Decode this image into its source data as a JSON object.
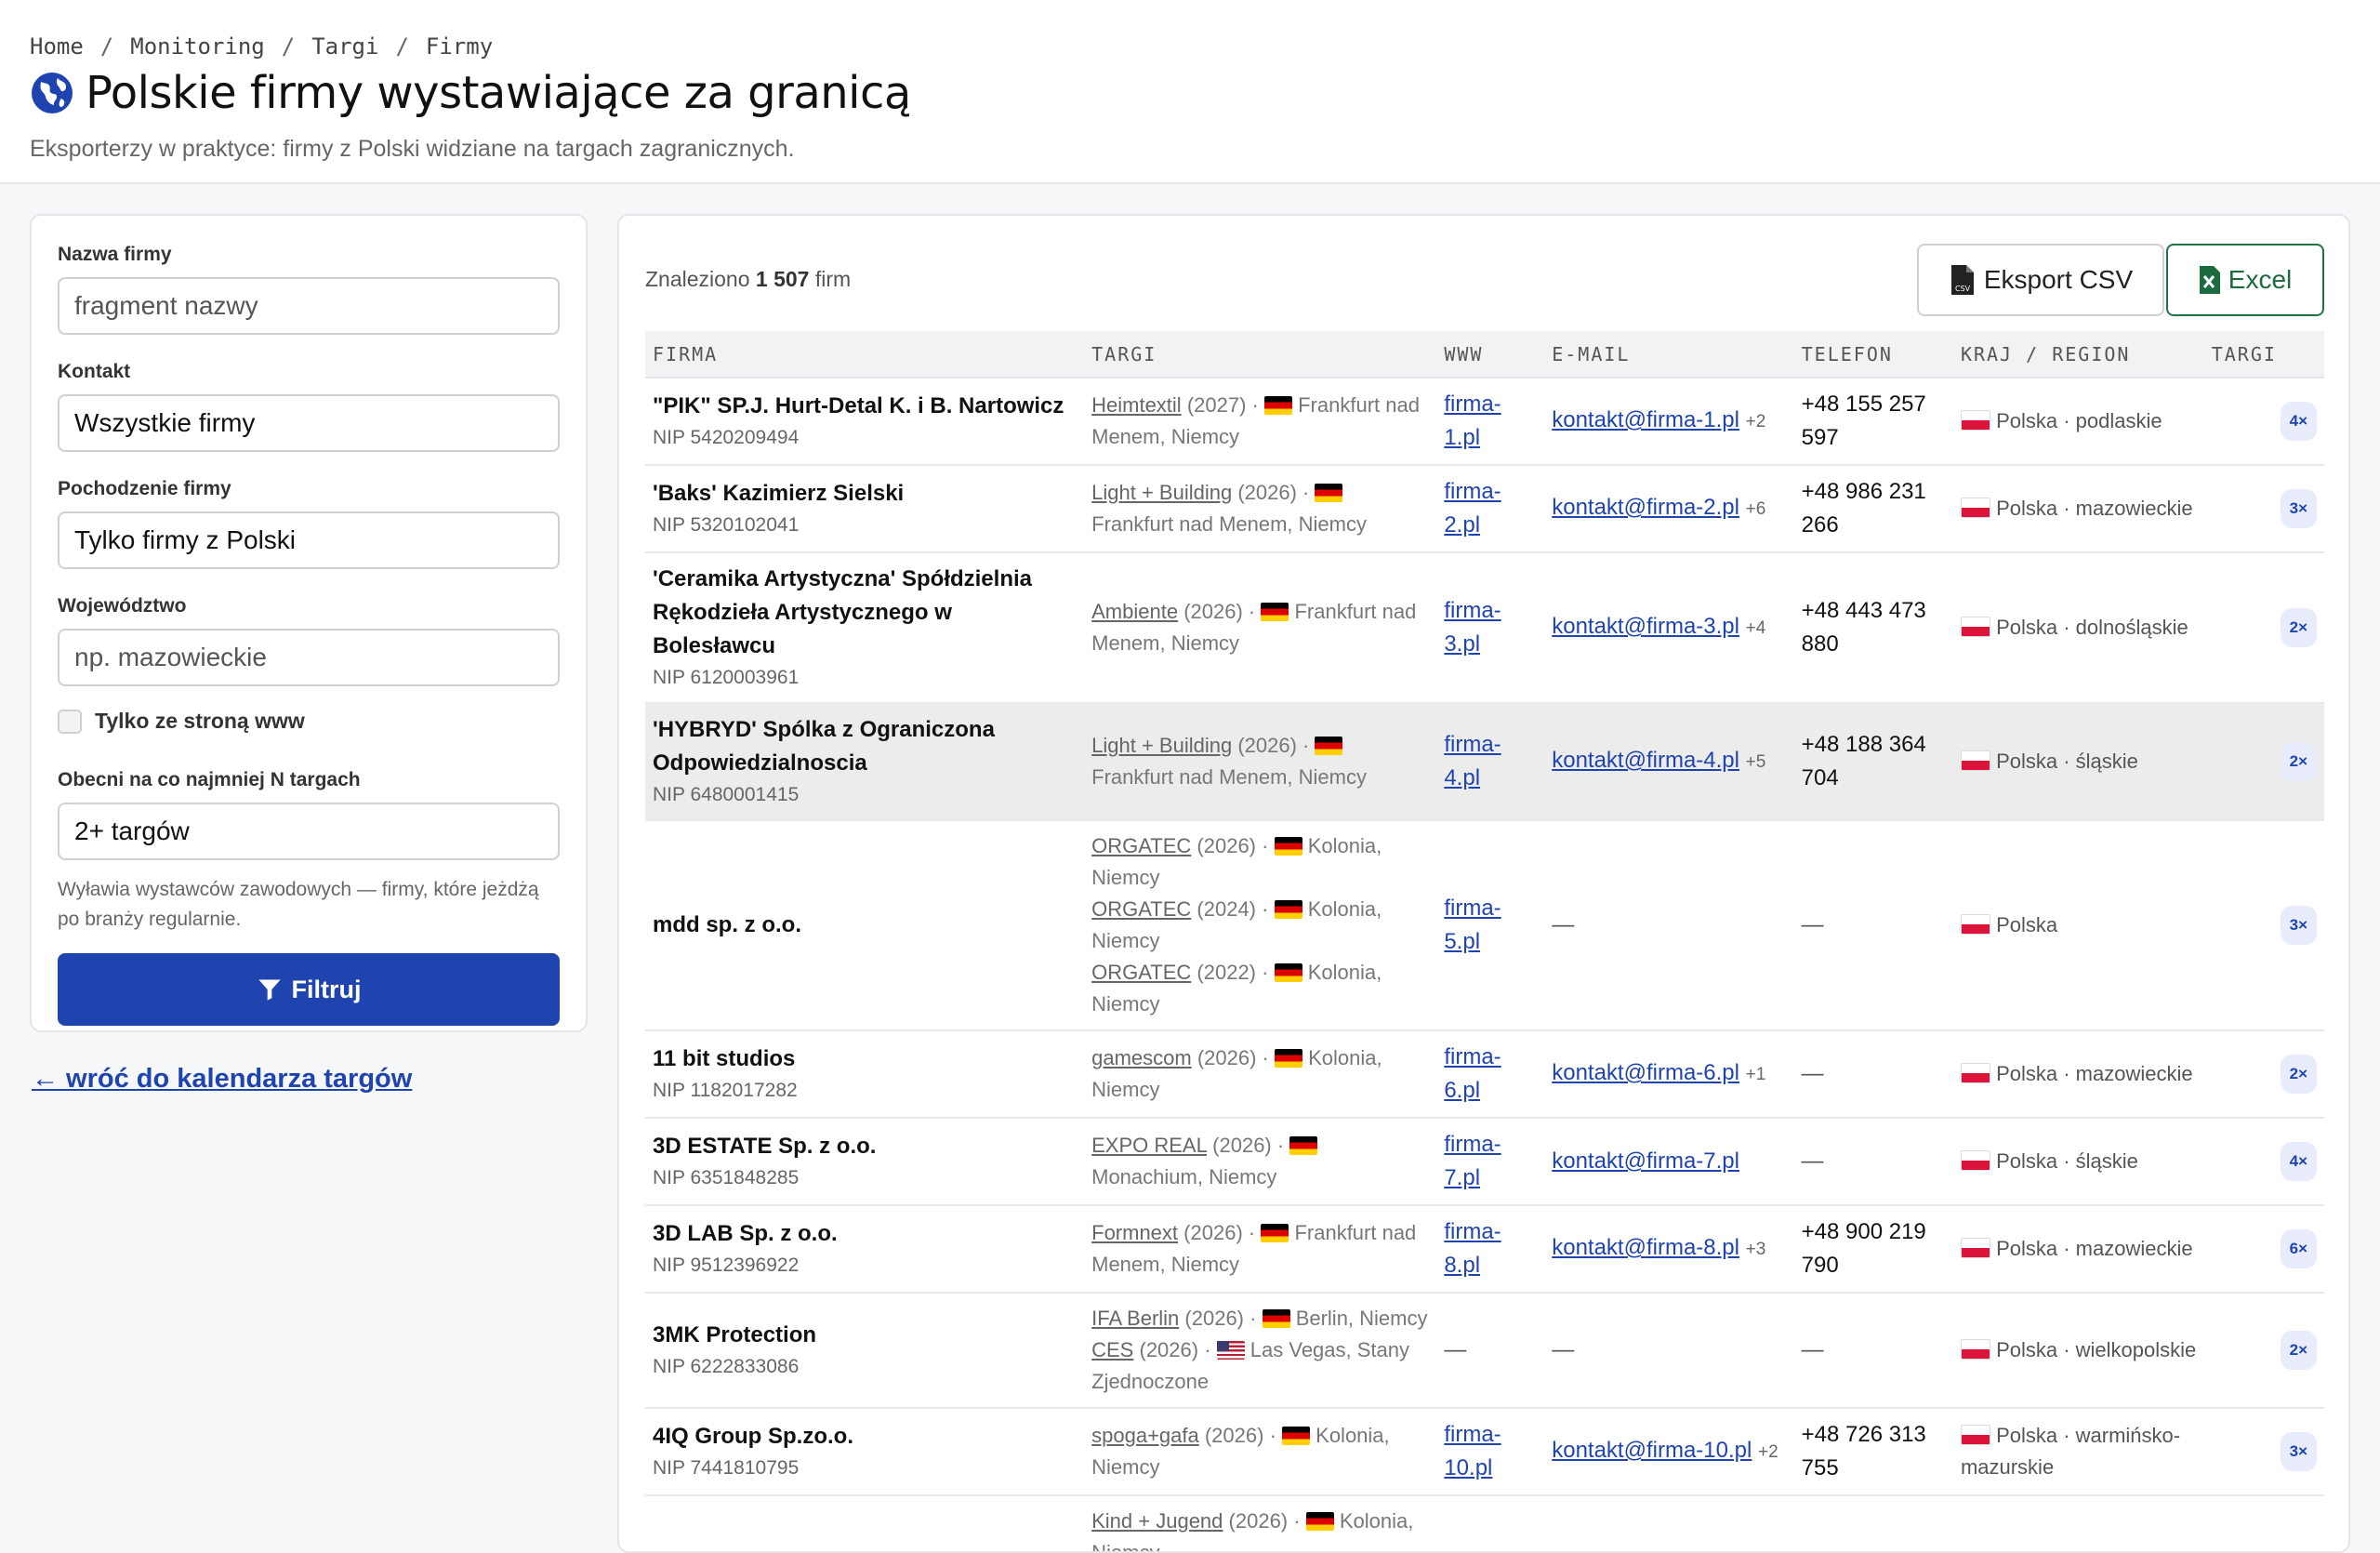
{
  "breadcrumb": [
    "Home",
    "Monitoring",
    "Targi",
    "Firmy"
  ],
  "page": {
    "title": "Polskie firmy wystawiające za granicą",
    "subtitle": "Eksporterzy w praktyce: firmy z Polski widziane na targach zagranicznych."
  },
  "filters": {
    "name_label": "Nazwa firmy",
    "name_placeholder": "fragment nazwy",
    "contact_label": "Kontakt",
    "contact_value": "Wszystkie firmy",
    "origin_label": "Pochodzenie firmy",
    "origin_value": "Tylko firmy z Polski",
    "voivodeship_label": "Województwo",
    "voivodeship_placeholder": "np. mazowieckie",
    "www_only_label": "Tylko ze stroną www",
    "min_fairs_label": "Obecni na co najmniej N targach",
    "min_fairs_value": "2+ targów",
    "hint": "Wyławia wystawców zawodowych — firmy, które jeżdżą po branży regularnie.",
    "submit_label": "Filtruj"
  },
  "back_link": "← wróć do kalendarza targów",
  "results": {
    "found_prefix": "Znaleziono",
    "found_count": "1 507",
    "found_suffix": "firm",
    "export_csv_label": "Eksport CSV",
    "excel_label": "Excel",
    "columns": [
      "FIRMA",
      "TARGI",
      "WWW",
      "E-MAIL",
      "TELEFON",
      "KRAJ / REGION",
      "TARGI"
    ],
    "rows": [
      {
        "name": "\"PIK\" SP.J. Hurt-Detal K. i B. Nartowicz",
        "nip": "NIP 5420209494",
        "fairs": [
          {
            "name": "Heimtextil",
            "year": "(2027)",
            "flag": "de",
            "loc": "Frankfurt nad Menem, Niemcy"
          }
        ],
        "www": "firma-1.pl",
        "email": "kontakt@firma-1.pl",
        "email_extra": "+2",
        "phone": "+48 155 257 597",
        "country": "Polska · podlaskie",
        "count": "4×"
      },
      {
        "name": "'Baks' Kazimierz Sielski",
        "nip": "NIP 5320102041",
        "fairs": [
          {
            "name": "Light + Building",
            "year": "(2026)",
            "flag": "de",
            "loc": "Frankfurt nad Menem, Niemcy"
          }
        ],
        "www": "firma-2.pl",
        "email": "kontakt@firma-2.pl",
        "email_extra": "+6",
        "phone": "+48 986 231 266",
        "country": "Polska · mazowieckie",
        "count": "3×"
      },
      {
        "name": "'Ceramika Artystyczna' Spółdzielnia Rękodzieła Artystycznego w Bolesławcu",
        "nip": "NIP 6120003961",
        "fairs": [
          {
            "name": "Ambiente",
            "year": "(2026)",
            "flag": "de",
            "loc": "Frankfurt nad Menem, Niemcy"
          }
        ],
        "www": "firma-3.pl",
        "email": "kontakt@firma-3.pl",
        "email_extra": "+4",
        "phone": "+48 443 473 880",
        "country": "Polska · dolnośląskie",
        "count": "2×"
      },
      {
        "name": "'HYBRYD' Spólka z Ograniczona Odpowiedzialnoscia",
        "nip": "NIP 6480001415",
        "fairs": [
          {
            "name": "Light + Building",
            "year": "(2026)",
            "flag": "de",
            "loc": "Frankfurt nad Menem, Niemcy"
          }
        ],
        "www": "firma-4.pl",
        "email": "kontakt@firma-4.pl",
        "email_extra": "+5",
        "phone": "+48 188 364 704",
        "country": "Polska · śląskie",
        "count": "2×",
        "highlight": true
      },
      {
        "name": "mdd sp. z o.o.",
        "nip": "",
        "fairs": [
          {
            "name": "ORGATEC",
            "year": "(2026)",
            "flag": "de",
            "loc": "Kolonia, Niemcy"
          },
          {
            "name": "ORGATEC",
            "year": "(2024)",
            "flag": "de",
            "loc": "Kolonia, Niemcy"
          },
          {
            "name": "ORGATEC",
            "year": "(2022)",
            "flag": "de",
            "loc": "Kolonia, Niemcy"
          }
        ],
        "www": "firma-5.pl",
        "email": "",
        "email_extra": "",
        "phone": "",
        "country": "Polska",
        "count": "3×"
      },
      {
        "name": "11 bit studios",
        "nip": "NIP 1182017282",
        "fairs": [
          {
            "name": "gamescom",
            "year": "(2026)",
            "flag": "de",
            "loc": "Kolonia, Niemcy"
          }
        ],
        "www": "firma-6.pl",
        "email": "kontakt@firma-6.pl",
        "email_extra": "+1",
        "phone": "",
        "country": "Polska · mazowieckie",
        "count": "2×"
      },
      {
        "name": "3D ESTATE Sp. z o.o.",
        "nip": "NIP 6351848285",
        "fairs": [
          {
            "name": "EXPO REAL",
            "year": "(2026)",
            "flag": "de",
            "loc": "Monachium, Niemcy"
          }
        ],
        "www": "firma-7.pl",
        "email": "kontakt@firma-7.pl",
        "email_extra": "",
        "phone": "",
        "country": "Polska · śląskie",
        "count": "4×"
      },
      {
        "name": "3D LAB Sp. z o.o.",
        "nip": "NIP 9512396922",
        "fairs": [
          {
            "name": "Formnext",
            "year": "(2026)",
            "flag": "de",
            "loc": "Frankfurt nad Menem, Niemcy"
          }
        ],
        "www": "firma-8.pl",
        "email": "kontakt@firma-8.pl",
        "email_extra": "+3",
        "phone": "+48 900 219 790",
        "country": "Polska · mazowieckie",
        "count": "6×"
      },
      {
        "name": "3MK Protection",
        "nip": "NIP 6222833086",
        "fairs": [
          {
            "name": "IFA Berlin",
            "year": "(2026)",
            "flag": "de",
            "loc": "Berlin, Niemcy"
          },
          {
            "name": "CES",
            "year": "(2026)",
            "flag": "us",
            "loc": "Las Vegas, Stany Zjednoczone"
          }
        ],
        "www": "",
        "email": "",
        "email_extra": "",
        "phone": "",
        "country": "Polska · wielkopolskie",
        "count": "2×"
      },
      {
        "name": "4IQ Group Sp.zo.o.",
        "nip": "NIP 7441810795",
        "fairs": [
          {
            "name": "spoga+gafa",
            "year": "(2026)",
            "flag": "de",
            "loc": "Kolonia, Niemcy"
          }
        ],
        "www": "firma-10.pl",
        "email": "kontakt@firma-10.pl",
        "email_extra": "+2",
        "phone": "+48 726 313 755",
        "country": "Polska · warmińsko-mazurskie",
        "count": "3×"
      },
      {
        "name": "",
        "nip": "",
        "fairs": [
          {
            "name": "Kind + Jugend",
            "year": "(2026)",
            "flag": "de",
            "loc": "Kolonia, Niemcy"
          }
        ],
        "www": "",
        "email": "",
        "email_extra": "",
        "phone": "",
        "country": "",
        "count": "",
        "partial": true
      }
    ],
    "empty_value": "—"
  },
  "icons": {
    "title": "globe-icon",
    "csv": "csv-file-icon",
    "excel": "excel-file-icon",
    "filter": "filter-icon"
  },
  "colors": {
    "primary": "#1f44b0",
    "excel": "#217346",
    "badge_bg": "#e9edfb"
  }
}
